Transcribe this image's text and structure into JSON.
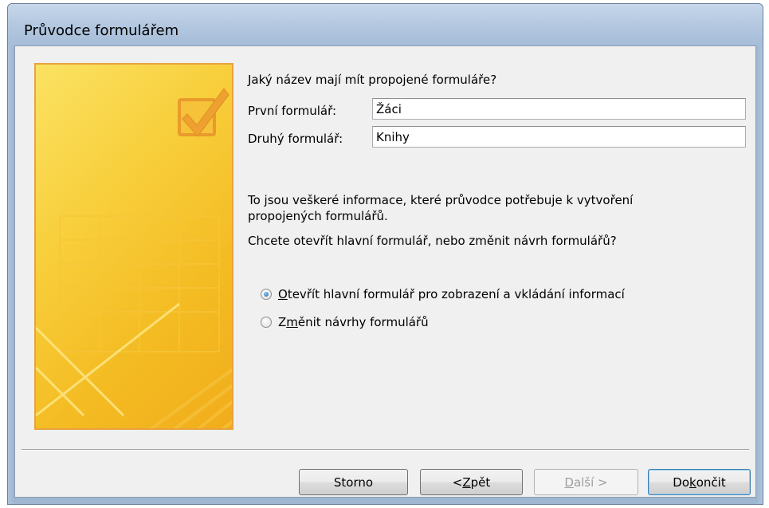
{
  "window": {
    "title": "Průvodce formulářem"
  },
  "form": {
    "question": "Jaký název mají mít propojené formuláře?",
    "first_label": "První formulář:",
    "first_value": "Žáci",
    "second_label": "Druhý formulář:",
    "second_value": "Knihy"
  },
  "info": {
    "line1": "To jsou veškeré informace, které průvodce potřebuje k vytvoření propojených formulářů.",
    "line2": "Chcete otevřít hlavní formulář, nebo změnit návrh formulářů?"
  },
  "options": [
    {
      "prefix": "",
      "mnemonic": "O",
      "rest": "tevřít hlavní formulář pro zobrazení a vkládání informací",
      "selected": true
    },
    {
      "prefix": "Z",
      "mnemonic": "m",
      "rest": "ěnit návrhy formulářů",
      "selected": false
    }
  ],
  "buttons": {
    "cancel": "Storno",
    "back_prefix": "< ",
    "back_mnemonic": "Z",
    "back_rest": "pět",
    "next_mnemonic": "D",
    "next_rest": "alší >",
    "finish_prefix": "Do",
    "finish_mnemonic": "k",
    "finish_rest": "ončit"
  },
  "colors": {
    "banner_yellow": "#f8cf3c",
    "banner_border": "#e8a33c",
    "radio_dot": "#1c64b0"
  },
  "icons": {
    "banner": "checkbox-check-icon"
  }
}
